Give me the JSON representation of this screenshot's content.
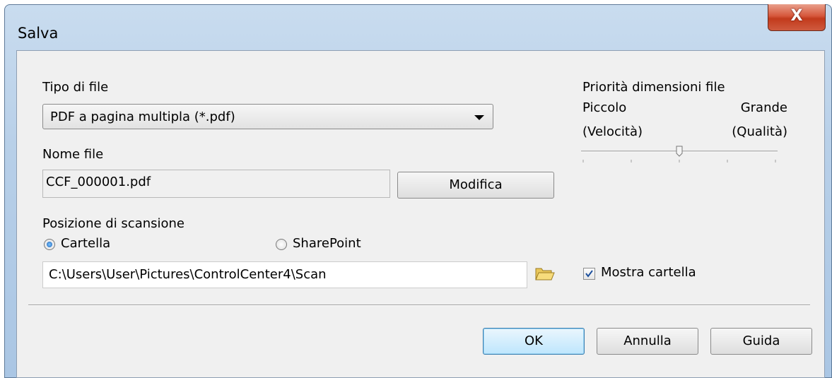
{
  "window": {
    "title": "Salva",
    "close_label": "X"
  },
  "file_type": {
    "label": "Tipo di file",
    "selected": "PDF a pagina multipla (*.pdf)"
  },
  "file_name": {
    "label": "Nome file",
    "value": "CCF_000001.pdf",
    "edit_label": "Modifica"
  },
  "size_priority": {
    "label": "Priorità dimensioni file",
    "min_label": "Piccolo",
    "min_sub": "(Velocità)",
    "max_label": "Grande",
    "max_sub": "(Qualità)",
    "level": 0.5
  },
  "scan_location": {
    "label": "Posizione di scansione",
    "option_folder": "Cartella",
    "option_sharepoint": "SharePoint",
    "selected": "Cartella",
    "path": "C:\\Users\\User\\Pictures\\ControlCenter4\\Scan"
  },
  "show_folder": {
    "label": "Mostra cartella",
    "checked": true
  },
  "buttons": {
    "ok": "OK",
    "cancel": "Annulla",
    "help": "Guida"
  },
  "colors": {
    "accent": "#3c7fb1",
    "close": "#c23a1c",
    "titlebar": "#b7cfe8"
  }
}
